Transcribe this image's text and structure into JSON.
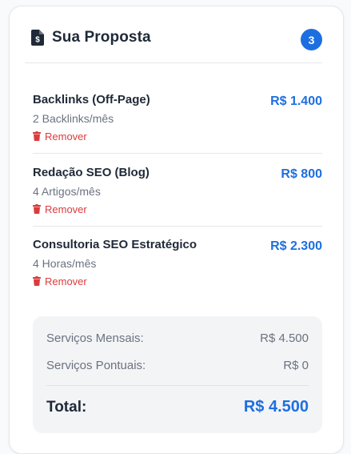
{
  "proposal": {
    "title": "Sua Proposta",
    "count": "3",
    "items": [
      {
        "name": "Backlinks (Off-Page)",
        "detail": "2 Backlinks/mês",
        "price": "R$ 1.400",
        "remove_label": "Remover"
      },
      {
        "name": "Redação SEO (Blog)",
        "detail": "4 Artigos/mês",
        "price": "R$ 800",
        "remove_label": "Remover"
      },
      {
        "name": "Consultoria SEO Estratégico",
        "detail": "4 Horas/mês",
        "price": "R$ 2.300",
        "remove_label": "Remover"
      }
    ]
  },
  "summary": {
    "monthly_label": "Serviços Mensais:",
    "monthly_value": "R$ 4.500",
    "onetime_label": "Serviços Pontuais:",
    "onetime_value": "R$ 0",
    "total_label": "Total:",
    "total_value": "R$ 4.500"
  },
  "colors": {
    "accent": "#1d6fe0",
    "danger": "#dc3b3b",
    "text_dark": "#1f2937",
    "text_muted": "#6b7280"
  },
  "icons": {
    "header": "file-invoice-dollar-icon",
    "remove": "trash-icon"
  }
}
